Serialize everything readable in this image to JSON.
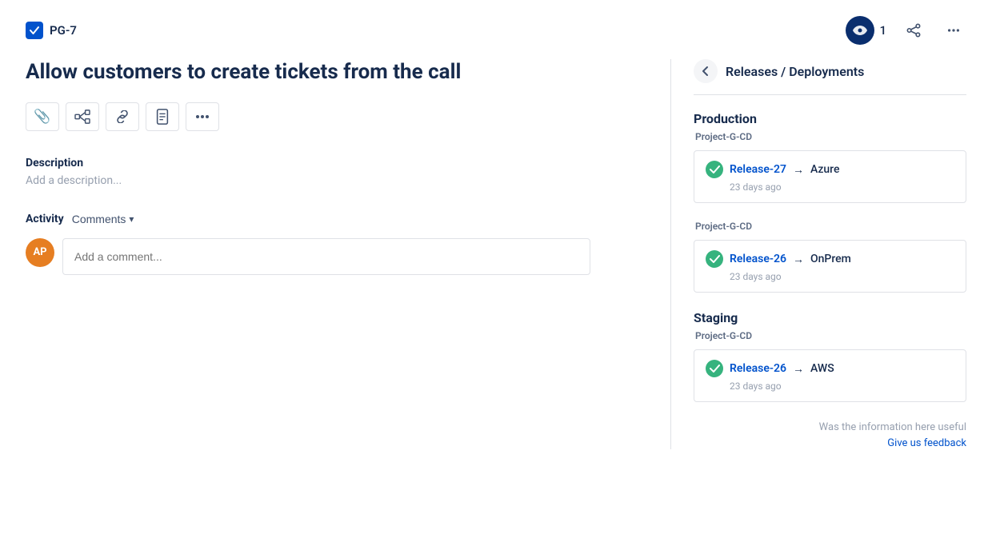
{
  "header": {
    "ticket_id": "PG-7",
    "watch_count": "1",
    "share_label": "share",
    "more_label": "more"
  },
  "issue": {
    "title": "Allow customers to create tickets from the call",
    "description_label": "Description",
    "description_placeholder": "Add a description..."
  },
  "toolbar": {
    "attach_icon": "📎",
    "diagram_icon": "🔗",
    "link_icon": "🔗",
    "doc_icon": "📋",
    "more_icon": "···"
  },
  "activity": {
    "label": "Activity",
    "filter_label": "Comments",
    "comment_placeholder": "Add a comment...",
    "user_initials": "AP"
  },
  "right_panel": {
    "title": "Releases / Deployments",
    "back_label": "back",
    "environments": [
      {
        "name": "Production",
        "project": "Project-G-CD",
        "deployments": [
          {
            "release": "Release-27",
            "target": "Azure",
            "timestamp": "23 days ago"
          }
        ]
      },
      {
        "name": "",
        "project": "Project-G-CD",
        "deployments": [
          {
            "release": "Release-26",
            "target": "OnPrem",
            "timestamp": "23 days ago"
          }
        ]
      },
      {
        "name": "Staging",
        "project": "Project-G-CD",
        "deployments": [
          {
            "release": "Release-26",
            "target": "AWS",
            "timestamp": "23 days ago"
          }
        ]
      }
    ],
    "feedback_text": "Was the information here useful",
    "feedback_link": "Give us feedback"
  }
}
